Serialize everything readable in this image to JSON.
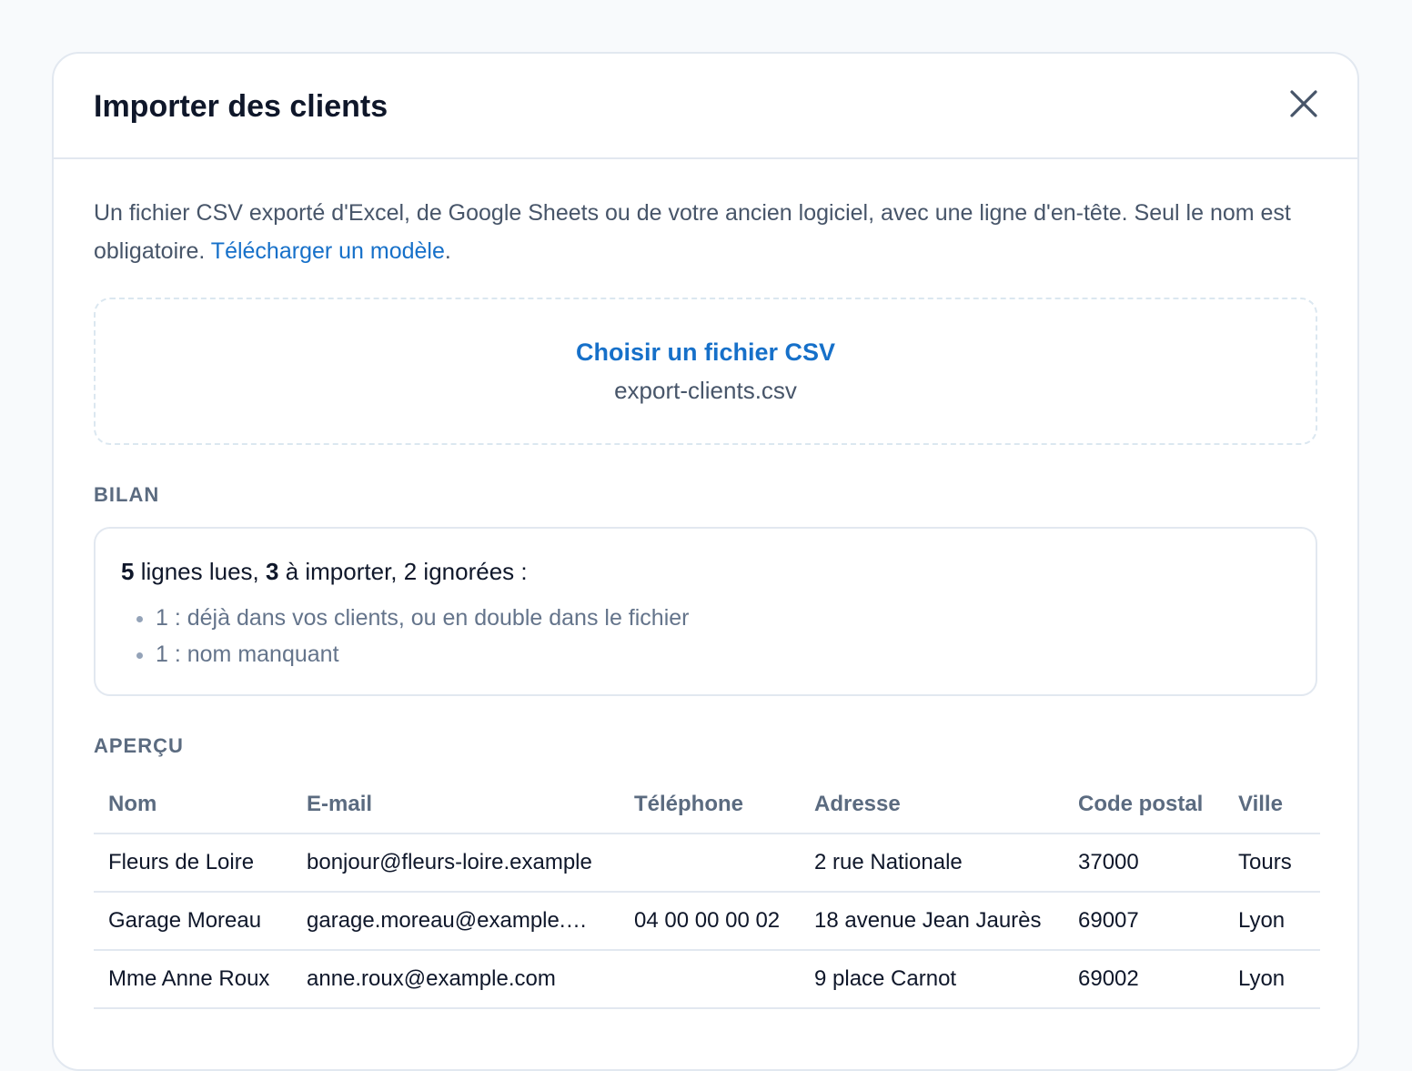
{
  "modal": {
    "title": "Importer des clients",
    "close_icon": "close-icon"
  },
  "intro": {
    "text": "Un fichier CSV exporté d'Excel, de Google Sheets ou de votre ancien logiciel, avec une ligne d'en-tête. Seul le nom est obligatoire. ",
    "template_link": "Télécharger un modèle",
    "trailing": "."
  },
  "dropzone": {
    "choose_label": "Choisir un fichier CSV",
    "filename": "export-clients.csv"
  },
  "summary": {
    "heading": "BILAN",
    "read_count": "5",
    "read_label": " lignes lues, ",
    "import_count": "3",
    "import_label": " à importer, 2 ignorées :",
    "items": [
      "1 : déjà dans vos clients, ou en double dans le fichier",
      "1 : nom manquant"
    ]
  },
  "preview": {
    "heading": "APERÇU",
    "columns": [
      "Nom",
      "E-mail",
      "Téléphone",
      "Adresse",
      "Code postal",
      "Ville"
    ],
    "rows": [
      [
        "Fleurs de Loire",
        "bonjour@fleurs-loire.example",
        "",
        "2 rue Nationale",
        "37000",
        "Tours"
      ],
      [
        "Garage Moreau",
        "garage.moreau@example.…",
        "04 00 00 00 02",
        "18 avenue Jean Jaurès",
        "69007",
        "Lyon"
      ],
      [
        "Mme Anne Roux",
        "anne.roux@example.com",
        "",
        "9 place Carnot",
        "69002",
        "Lyon"
      ]
    ]
  },
  "colors": {
    "accent": "#1670c9",
    "text": "#0f172a",
    "muted": "#475569",
    "border": "#e2e8f0"
  }
}
